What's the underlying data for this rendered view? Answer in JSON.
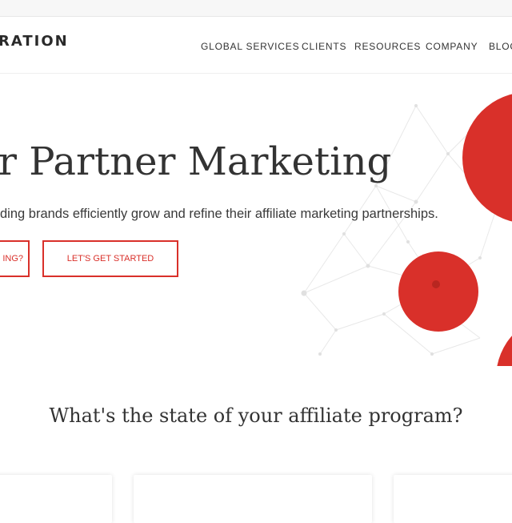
{
  "header": {
    "logo_text": "RATION",
    "nav": [
      {
        "label": "GLOBAL SERVICES"
      },
      {
        "label": "CLIENTS"
      },
      {
        "label": "RESOURCES"
      },
      {
        "label": "COMPANY"
      },
      {
        "label": "BLOG"
      }
    ]
  },
  "hero": {
    "title": "r Partner Marketing",
    "subtitle": "ding brands efficiently grow and refine their affiliate marketing partnerships.",
    "buttons": [
      {
        "label": "ING?"
      },
      {
        "label": "LET'S GET STARTED"
      }
    ]
  },
  "section": {
    "title": "What's the state of your affiliate program?"
  },
  "colors": {
    "accent": "#d9302a",
    "text": "#333333",
    "network": "#e6e6e6"
  }
}
